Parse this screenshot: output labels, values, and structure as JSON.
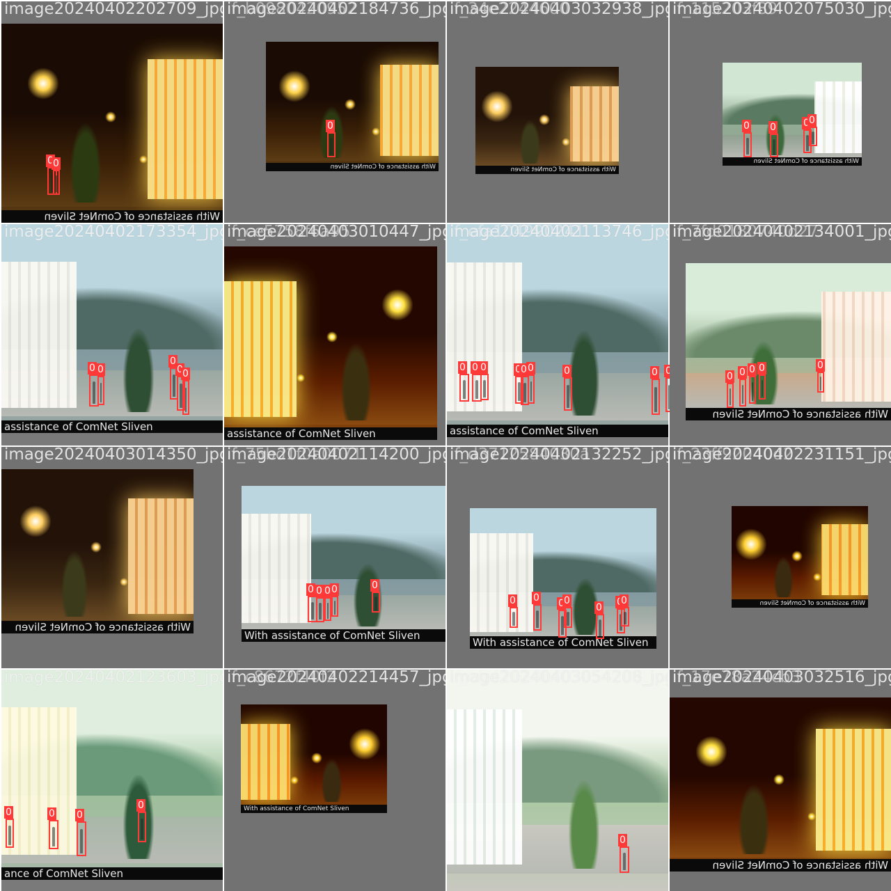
{
  "mosaic": {
    "tiles": [
      {
        "name": "image20240402202709_jpg",
        "overlay": "",
        "scene": "night",
        "strip": "With assistance of ComNet Sliven",
        "mirrored": true,
        "boxes": [
          {
            "label": "0"
          },
          {
            "label": "0"
          }
        ]
      },
      {
        "name": "image20240402184736_jpg",
        "overlay": "if_b0980420952",
        "scene": "night",
        "strip": "With assistance of ComNet Sliven",
        "mirrored": true,
        "boxes": [
          {
            "label": "0"
          }
        ]
      },
      {
        "name": "image20240403032938_jpg",
        "overlay": "if_34e2244600",
        "scene": "night-dim",
        "strip": "With assistance of ComNet Sliven",
        "mirrored": true,
        "boxes": []
      },
      {
        "name": "image20240402075030_jpg",
        "overlay": "if_115203f89",
        "scene": "day-small",
        "strip": "With assistance of ComNet Sliven",
        "mirrored": true,
        "boxes": [
          {
            "label": "0"
          },
          {
            "label": "0"
          },
          {
            "label": "0"
          },
          {
            "label": "0"
          }
        ]
      },
      {
        "name": "image20240402173354_jpg",
        "overlay": "",
        "scene": "day",
        "strip": "assistance of ComNet Sliven",
        "mirrored": false,
        "boxes": [
          {
            "label": "0"
          },
          {
            "label": "0"
          },
          {
            "label": "0"
          },
          {
            "label": "0"
          },
          {
            "label": "0"
          }
        ]
      },
      {
        "name": "image20240403010447_jpg",
        "overlay": "if_ce5758f6a95",
        "scene": "night-bright",
        "strip": "assistance of ComNet Sliven",
        "mirrored": false,
        "boxes": []
      },
      {
        "name": "image20240402113746_jpg",
        "overlay": "if_efa104990241",
        "scene": "day",
        "strip": "assistance of ComNet Sliven",
        "mirrored": false,
        "boxes": [
          {
            "label": "0"
          },
          {
            "label": "0"
          },
          {
            "label": "0"
          },
          {
            "label": "0"
          },
          {
            "label": "0"
          },
          {
            "label": "0"
          },
          {
            "label": "0"
          },
          {
            "label": "0"
          },
          {
            "label": "0"
          }
        ]
      },
      {
        "name": "image20240402134001_jpg",
        "overlay": "if_7fd0180740d27",
        "scene": "day-pale",
        "strip": "With assistance of ComNet Sliven",
        "mirrored": true,
        "boxes": [
          {
            "label": "0"
          },
          {
            "label": "0"
          },
          {
            "label": "0"
          },
          {
            "label": "0"
          },
          {
            "label": "0"
          }
        ]
      },
      {
        "name": "image20240403014350_jpg",
        "overlay": "",
        "scene": "night-dim",
        "strip": "With assistance of ComNet Sliven",
        "mirrored": true,
        "boxes": []
      },
      {
        "name": "image20240402114200_jpg",
        "overlay": "if_75bd1f0a0071",
        "scene": "day",
        "strip": "With assistance of ComNet Sliven",
        "mirrored": false,
        "boxes": [
          {
            "label": "0"
          },
          {
            "label": "0"
          },
          {
            "label": "0"
          },
          {
            "label": "0"
          },
          {
            "label": "0"
          }
        ]
      },
      {
        "name": "image20240402132252_jpg",
        "overlay": "if_d3712584030a",
        "scene": "day",
        "strip": "With assistance of ComNet Sliven",
        "mirrored": false,
        "boxes": [
          {
            "label": "0"
          },
          {
            "label": "0"
          },
          {
            "label": "0"
          },
          {
            "label": "0"
          },
          {
            "label": "0"
          },
          {
            "label": "0"
          },
          {
            "label": "0"
          }
        ]
      },
      {
        "name": "image20240402231151_jpg",
        "overlay": "if_23ff92040d2",
        "scene": "night-small",
        "strip": "With assistance of ComNet Sliven",
        "mirrored": true,
        "boxes": []
      },
      {
        "name": "image20240402123603_jpg",
        "overlay": "",
        "scene": "day-wide",
        "strip": "ance of ComNet Sliven",
        "mirrored": false,
        "boxes": [
          {
            "label": "0"
          },
          {
            "label": "0"
          },
          {
            "label": "0"
          },
          {
            "label": "0"
          }
        ]
      },
      {
        "name": "image20240402214457_jpg",
        "overlay": "if_c8672f40f2",
        "scene": "night-small",
        "strip": "With assistance of ComNet Sliven",
        "mirrored": false,
        "boxes": []
      },
      {
        "name": "image20240403054208_jpg",
        "overlay": "if_cfa12614d03",
        "scene": "day-flip",
        "strip": "",
        "mirrored": false,
        "boxes": [
          {
            "label": "0"
          }
        ]
      },
      {
        "name": "image20240403032516_jpg",
        "overlay": "if_17e78a24cb3",
        "scene": "night-bright",
        "strip": "With assistance of ComNet Sliven",
        "mirrored": true,
        "boxes": []
      }
    ]
  }
}
